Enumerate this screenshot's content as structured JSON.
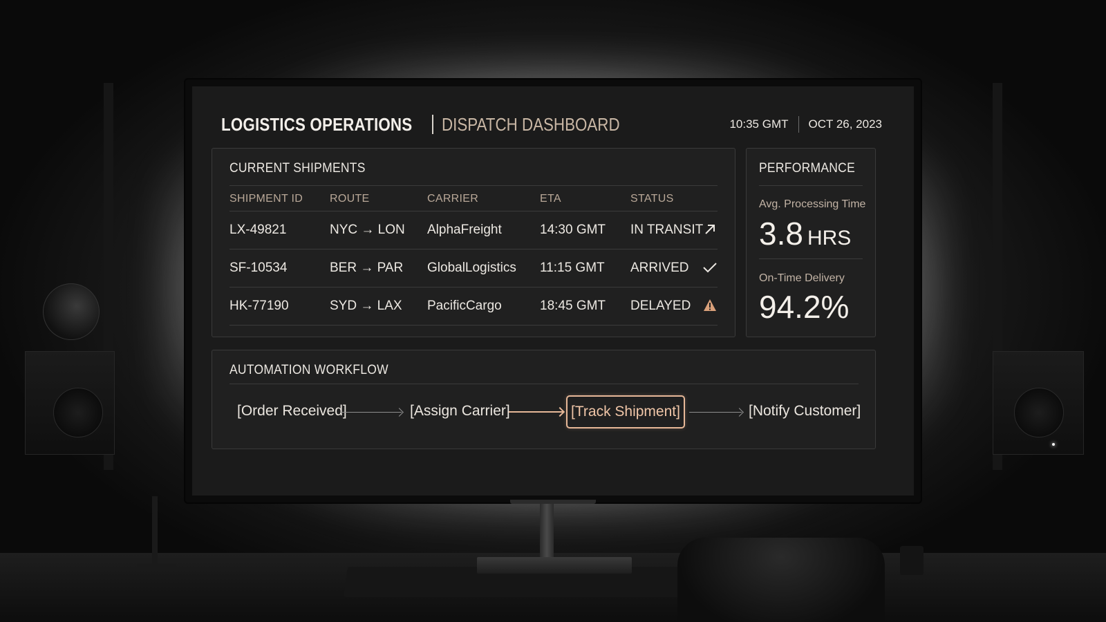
{
  "header": {
    "title": "LOGISTICS OPERATIONS",
    "subtitle": "DISPATCH DASHBOARD",
    "time": "10:35 GMT",
    "date": "OCT 26, 2023"
  },
  "shipments": {
    "title": "CURRENT SHIPMENTS",
    "columns": [
      "SHIPMENT ID",
      "ROUTE",
      "CARRIER",
      "ETA",
      "STATUS"
    ],
    "rows": [
      {
        "id": "LX-49821",
        "route": "NYC → LON",
        "carrier": "AlphaFreight",
        "eta": "14:30 GMT",
        "status": "IN TRANSIT",
        "icon": "arrow-up-right-icon"
      },
      {
        "id": "SF-10534",
        "route": "BER → PAR",
        "carrier": "GlobalLogistics",
        "eta": "11:15 GMT",
        "status": "ARRIVED",
        "icon": "checkmark-icon"
      },
      {
        "id": "HK-77190",
        "route": "SYD → LAX",
        "carrier": "PacificCargo",
        "eta": "18:45 GMT",
        "status": "DELAYED",
        "icon": "warning-icon"
      }
    ]
  },
  "performance": {
    "title": "PERFORMANCE",
    "metric1_label": "Avg. Processing Time",
    "metric1_value": "3.8",
    "metric1_unit": "HRS",
    "metric2_label": "On-Time Delivery",
    "metric2_value": "94.2%"
  },
  "workflow": {
    "title": "AUTOMATION WORKFLOW",
    "steps": [
      "[Order Received]",
      "[Assign Carrier]",
      "[Track Shipment]",
      "[Notify Customer]"
    ],
    "active_step": 2
  },
  "colors": {
    "accent": "#e7b898",
    "warning": "#d9a07a",
    "text": "#ece8e2",
    "panel_bg": "#202020"
  }
}
